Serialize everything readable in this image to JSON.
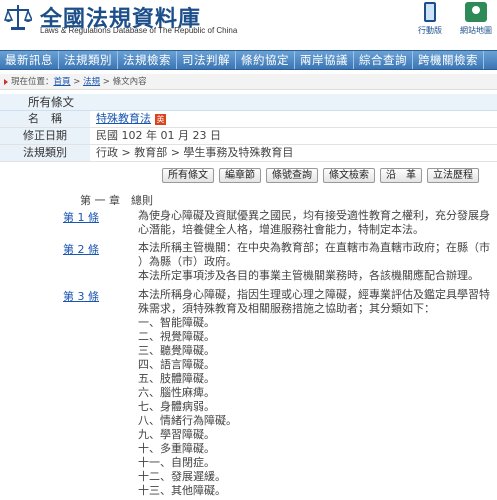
{
  "header": {
    "site_title": "全國法規資料庫",
    "site_subtitle": "Laws & Regulations Database of The Republic of China",
    "mobile_label": "行動版",
    "sitemap_label": "網站地圖"
  },
  "nav": {
    "items": [
      "最新訊息",
      "法規類別",
      "法規檢索",
      "司法判解",
      "條約協定",
      "兩岸協議",
      "綜合查詢",
      "跨機關檢索"
    ]
  },
  "breadcrumb": {
    "prefix": "現在位置：",
    "home": "首頁",
    "sep1": " > ",
    "laws": "法規",
    "sep2": " > ",
    "current": "條文內容"
  },
  "info": {
    "heading": "所有條文",
    "rows": [
      {
        "label": "名稱",
        "value": "特殊教育法",
        "badge": "英"
      },
      {
        "label": "修正日期",
        "value": "民國 102 年 01 月 23 日"
      },
      {
        "label": "法規類別",
        "value": "行政 > 教育部 > 學生事務及特殊教育目"
      }
    ]
  },
  "toolbar": {
    "buttons": [
      "所有條文",
      "編章節",
      "條號查詢",
      "條文檢索",
      "沿　革",
      "立法歷程"
    ]
  },
  "content": {
    "chapter": "第 一 章　總則",
    "articles": [
      {
        "no": "第 1 條",
        "lines": [
          "為使身心障礙及資賦優異之國民，均有接受適性教育之權利，充分發展身",
          "心潛能，培養健全人格，增進服務社會能力，特制定本法。"
        ]
      },
      {
        "no": "第 2 條",
        "lines": [
          "本法所稱主管機關：在中央為教育部；在直轄市為直轄市政府；在縣（市",
          "）為縣（市）政府。",
          "本法所定事項涉及各目的事業主管機關業務時，各該機關應配合辦理。"
        ]
      },
      {
        "no": "第 3 條",
        "lines": [
          "本法所稱身心障礙，指因生理或心理之障礙，經專業評估及鑑定具學習特",
          "殊需求，須特殊教育及相關服務措施之協助者；其分類如下：",
          "一、智能障礙。",
          "二、視覺障礙。",
          "三、聽覺障礙。",
          "四、語言障礙。",
          "五、肢體障礙。",
          "六、腦性麻痺。",
          "七、身體病弱。",
          "八、情緒行為障礙。",
          "九、學習障礙。",
          "十、多重障礙。",
          "十一、自閉症。",
          "十二、發展遲緩。",
          "十三、其他障礙。"
        ]
      }
    ]
  }
}
